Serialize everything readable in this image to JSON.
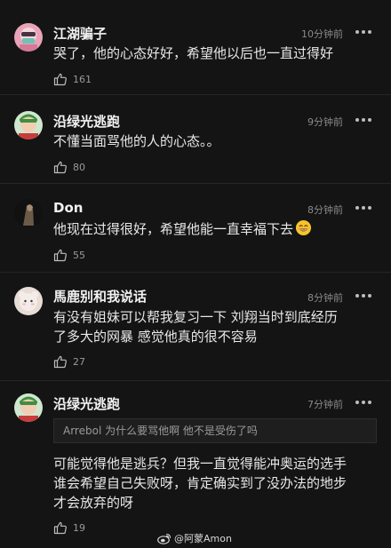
{
  "comments": [
    {
      "username": "江湖骗子",
      "time": "10分钟前",
      "lines": [
        "哭了，他的心态好好，希望他以后也一直过得好"
      ],
      "likes": "161"
    },
    {
      "username": "沿绿光逃跑",
      "time": "9分钟前",
      "lines": [
        "不懂当面骂他的人的心态。。"
      ],
      "likes": "80"
    },
    {
      "username": "Don",
      "time": "8分钟前",
      "lines": [
        "他现在过得很好，希望他能一直幸福下去"
      ],
      "emoji": "smiling-face-emoji",
      "likes": "55"
    },
    {
      "username": "馬鹿别和我说话",
      "time": "8分钟前",
      "lines": [
        "有没有姐妹可以帮我复习一下 刘翔当时到底经历",
        "了多大的网暴 感觉他真的很不容易"
      ],
      "likes": "27"
    },
    {
      "username": "沿绿光逃跑",
      "time": "7分钟前",
      "quote": "Arrebol 为什么要骂他啊  他不是受伤了吗",
      "lines": [
        "可能觉得他是逃兵？但我一直觉得能冲奥运的选手",
        "谁会希望自己失败呀，肯定确实到了没办法的地步",
        "才会放弃的呀"
      ],
      "likes": "19"
    }
  ],
  "watermark": "@阿蒙Amon",
  "icons": {
    "more": "more-dots-icon",
    "like": "thumbs-up-icon",
    "watermark": "weibo-logo-icon"
  },
  "colors": {
    "background": "#141414",
    "text": "#e8e8e8",
    "muted": "#8a8a8a"
  }
}
